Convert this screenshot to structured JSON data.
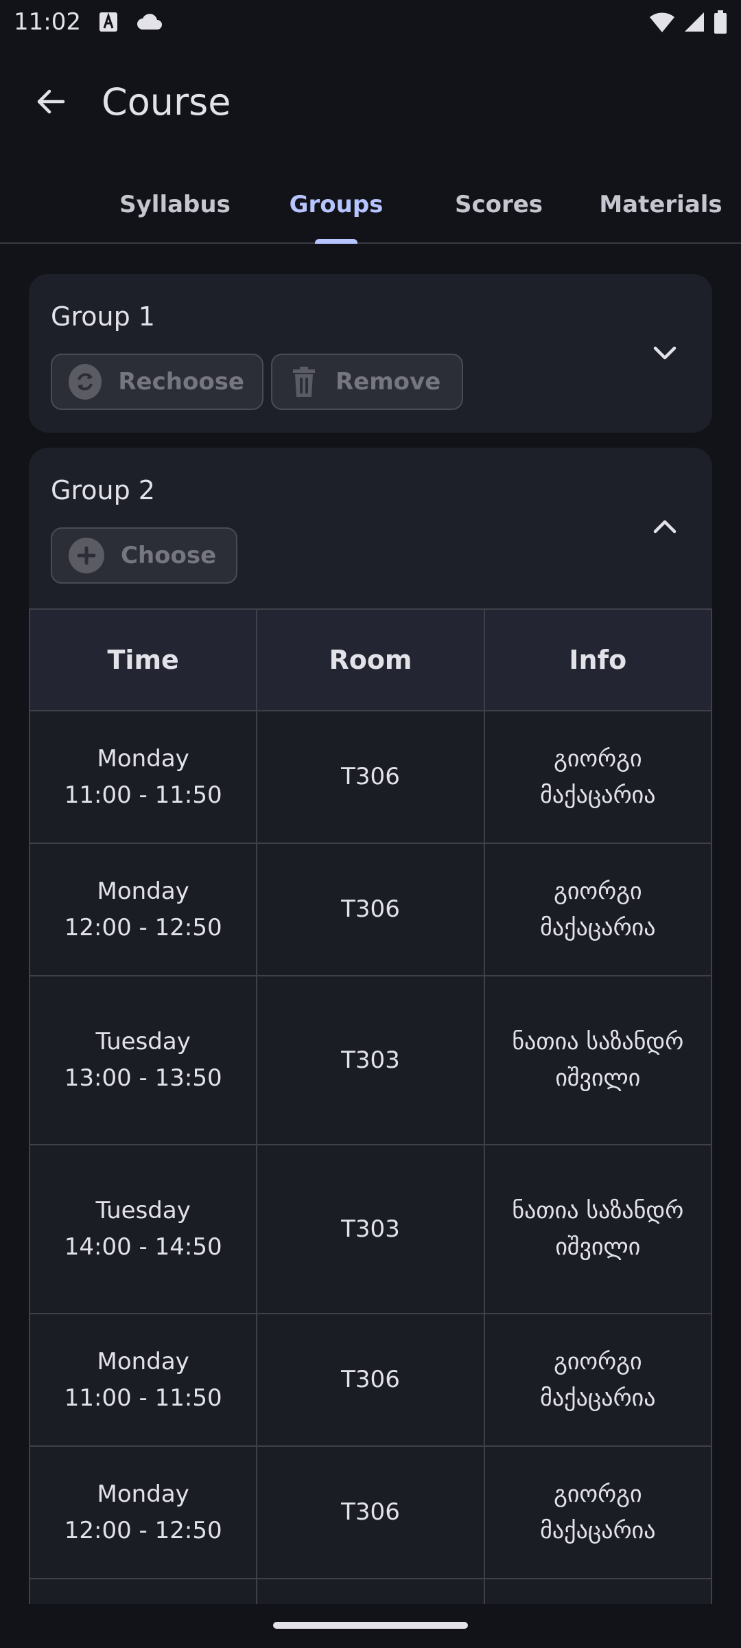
{
  "status_bar": {
    "time": "11:02",
    "icons": [
      "a-badge-icon",
      "cloud-icon",
      "wifi-icon",
      "signal-icon",
      "battery-icon"
    ]
  },
  "app_bar": {
    "title": "Course",
    "back_icon": "arrow-back-icon"
  },
  "tabs": [
    {
      "label": "Syllabus",
      "active": false
    },
    {
      "label": "Groups",
      "active": true
    },
    {
      "label": "Scores",
      "active": false
    },
    {
      "label": "Materials",
      "active": false
    }
  ],
  "groups": [
    {
      "title": "Group 1",
      "expanded": false,
      "actions": [
        {
          "label": "Rechoose",
          "icon": "sync-icon"
        },
        {
          "label": "Remove",
          "icon": "trash-icon"
        }
      ]
    },
    {
      "title": "Group 2",
      "expanded": true,
      "actions": [
        {
          "label": "Choose",
          "icon": "add-circle-icon"
        }
      ]
    }
  ],
  "schedule": {
    "headers": [
      "Time",
      "Room",
      "Info"
    ],
    "rows": [
      {
        "day": "Monday",
        "time": "11:00 - 11:50",
        "room": "T306",
        "info": "გიორგი მაქაცარია"
      },
      {
        "day": "Monday",
        "time": "12:00 - 12:50",
        "room": "T306",
        "info": "გიორგი მაქაცარია"
      },
      {
        "day": "Tuesday",
        "time": "13:00 - 13:50",
        "room": "T303",
        "info": "ნათია საზანდრიშვილი"
      },
      {
        "day": "Tuesday",
        "time": "14:00 - 14:50",
        "room": "T303",
        "info": "ნათია საზანდრიშვილი"
      },
      {
        "day": "Monday",
        "time": "11:00 - 11:50",
        "room": "T306",
        "info": "გიორგი მაქაცარია"
      },
      {
        "day": "Monday",
        "time": "12:00 - 12:50",
        "room": "T306",
        "info": "გიორგი მაქაცარია"
      },
      {
        "day": "",
        "time": "",
        "room": "",
        "info": ""
      }
    ]
  },
  "colors": {
    "background": "#121318",
    "surface": "#1e2029",
    "accent": "#b6c4ff",
    "disabled_text": "#75767f"
  }
}
